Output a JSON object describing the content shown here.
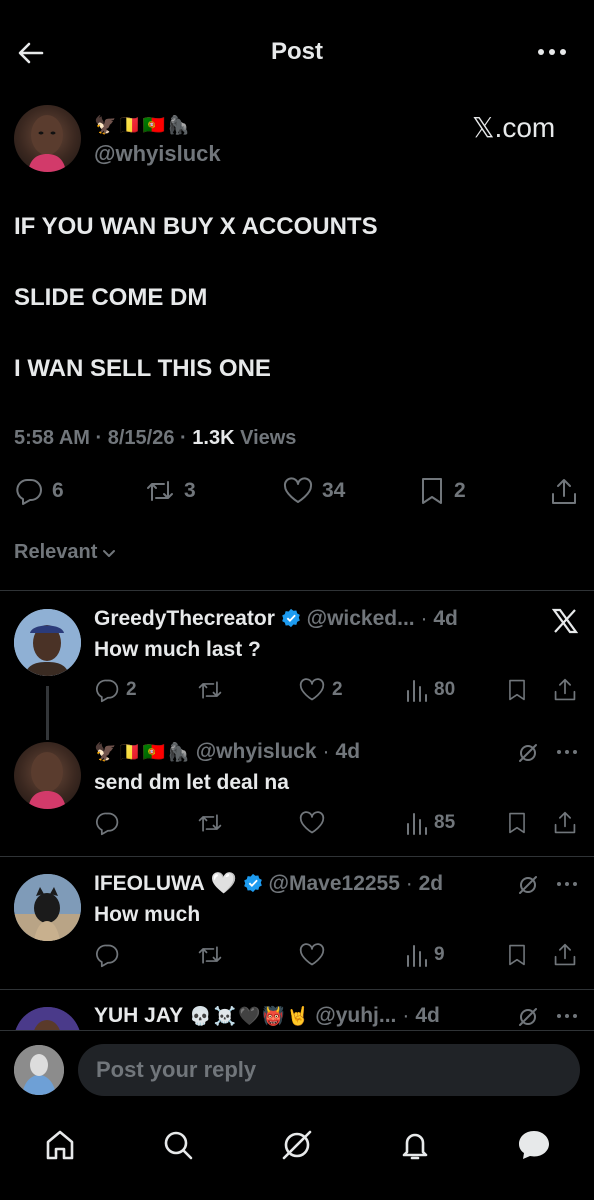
{
  "header": {
    "title": "Post"
  },
  "post": {
    "author_emojis": [
      "🦅",
      "🇧🇪",
      "🇵🇹",
      "🦍"
    ],
    "handle": "@whyisluck",
    "watermark": "𝕏.com",
    "lines": [
      "IF YOU WAN BUY X ACCOUNTS",
      "SLIDE COME DM",
      "I WAN SELL THIS ONE"
    ],
    "time": "5:58 AM",
    "date": "8/15/26",
    "views_count": "1.3K",
    "views_label": "Views",
    "sep": "·",
    "replies": "6",
    "reposts": "3",
    "likes": "34",
    "bookmarks": "2"
  },
  "sort": {
    "label": "Relevant"
  },
  "replies": [
    {
      "name": "GreedyThecreator",
      "handle": "@wicked...",
      "age": "4d",
      "text": "How much last ?",
      "replies": "2",
      "reposts": "",
      "likes": "2",
      "views": "80"
    },
    {
      "name_emojis": [
        "🦅",
        "🇧🇪",
        "🇵🇹",
        "🦍"
      ],
      "handle": "@whyisluck",
      "age": "4d",
      "text": "send dm let deal na",
      "views": "85"
    },
    {
      "name": "IFEOLUWA",
      "name_emoji": "🤍",
      "handle": "@Mave12255",
      "age": "2d",
      "text": "How much",
      "views": "9"
    },
    {
      "name": "YUH JAY",
      "name_emojis": [
        "💀",
        "☠️",
        "🖤",
        "👹",
        "🤘"
      ],
      "handle": "@yuhj...",
      "age": "4d"
    }
  ],
  "composer": {
    "placeholder": "Post your reply"
  },
  "colors": {
    "background": "#000000",
    "text": "#e7e9ea",
    "muted": "#71767b",
    "verified": "#1d9bf0",
    "divider": "#2f3336"
  }
}
